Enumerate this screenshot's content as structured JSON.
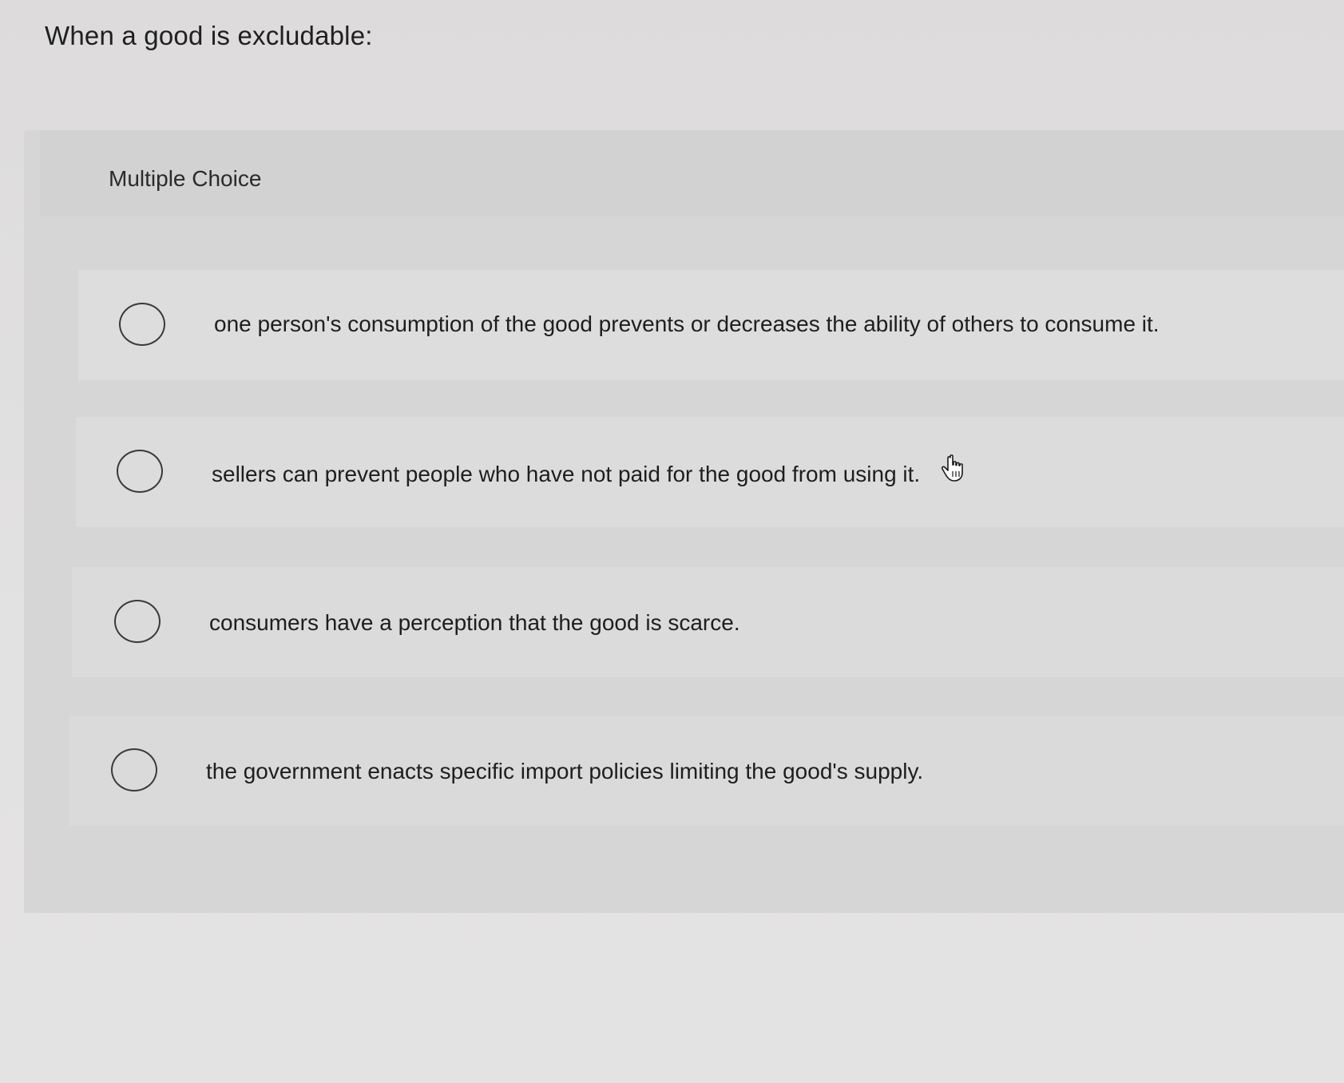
{
  "question": {
    "prompt": "When a good is excludable:"
  },
  "panel": {
    "type_label": "Multiple Choice"
  },
  "choices": [
    {
      "label": "one person's consumption of the good prevents or decreases the ability of others to consume it.",
      "selected": false
    },
    {
      "label": "sellers can prevent people who have not paid for the good from using it.",
      "selected": false
    },
    {
      "label": "consumers have a perception that the good is scarce.",
      "selected": false
    },
    {
      "label": "the government enacts specific import policies limiting the good's supply.",
      "selected": false
    }
  ],
  "cursor": {
    "icon": "hand-pointer-icon"
  }
}
